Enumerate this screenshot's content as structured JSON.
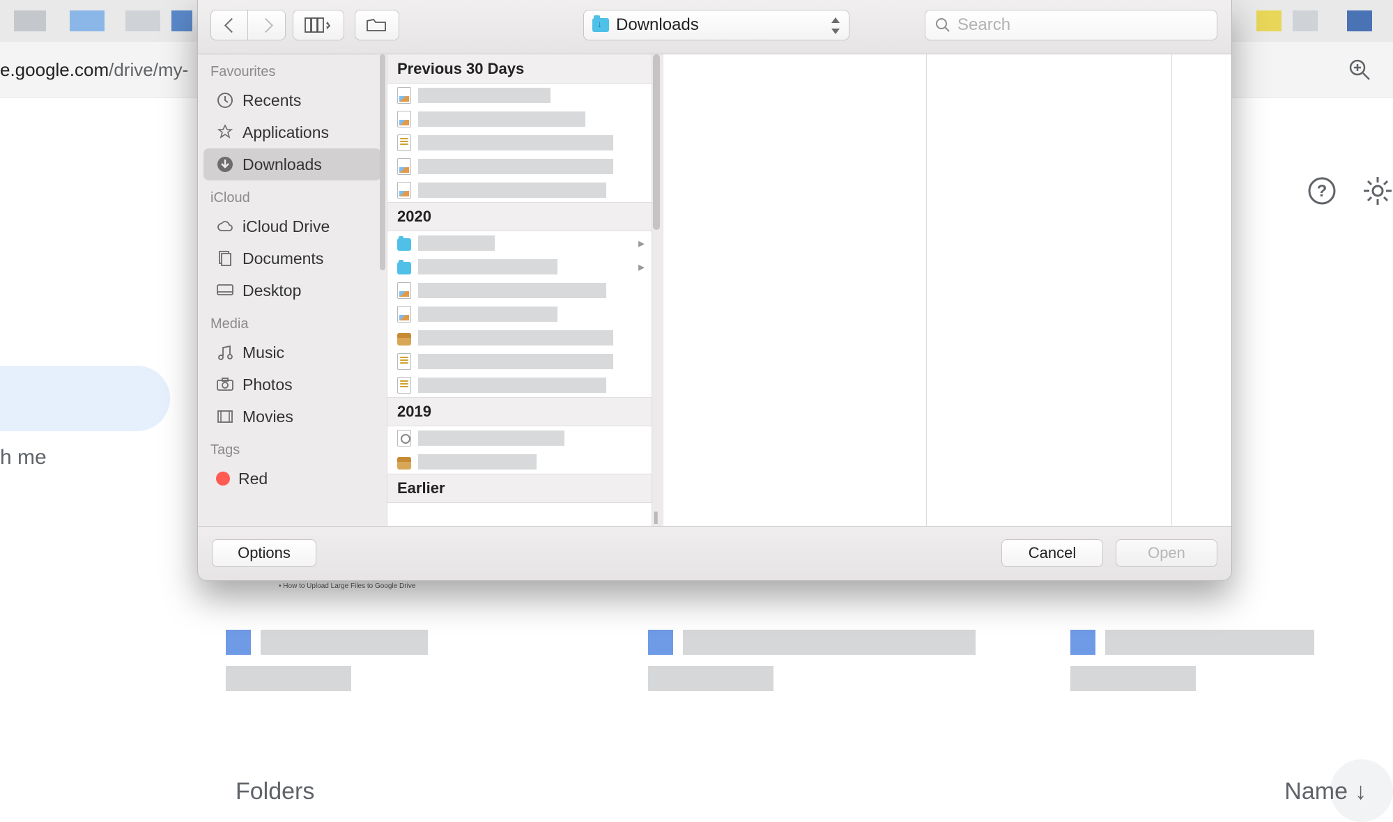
{
  "browser": {
    "url_prefix": "e.google.com",
    "url_rest": "/drive/my-"
  },
  "drive": {
    "left_truncated": "h me",
    "folders_label": "Folders",
    "name_label": "Name"
  },
  "toolbar": {
    "path_label": "Downloads",
    "search_placeholder": "Search"
  },
  "sidebar": {
    "sections": [
      {
        "title": "Favourites",
        "items": [
          {
            "key": "recents",
            "label": "Recents"
          },
          {
            "key": "applications",
            "label": "Applications"
          },
          {
            "key": "downloads",
            "label": "Downloads",
            "selected": true
          }
        ]
      },
      {
        "title": "iCloud",
        "items": [
          {
            "key": "icloud-drive",
            "label": "iCloud Drive"
          },
          {
            "key": "documents",
            "label": "Documents"
          },
          {
            "key": "desktop",
            "label": "Desktop"
          }
        ]
      },
      {
        "title": "Media",
        "items": [
          {
            "key": "music",
            "label": "Music"
          },
          {
            "key": "photos",
            "label": "Photos"
          },
          {
            "key": "movies",
            "label": "Movies"
          }
        ]
      },
      {
        "title": "Tags",
        "items": [
          {
            "key": "red",
            "label": "Red",
            "color": "#ff5b52"
          }
        ]
      }
    ]
  },
  "list": {
    "groups": [
      {
        "title": "Previous 30 Days",
        "rows": [
          {
            "type": "img"
          },
          {
            "type": "img"
          },
          {
            "type": "txt"
          },
          {
            "type": "img"
          },
          {
            "type": "img"
          }
        ]
      },
      {
        "title": "2020",
        "rows": [
          {
            "type": "fold",
            "expandable": true
          },
          {
            "type": "fold",
            "expandable": true
          },
          {
            "type": "img"
          },
          {
            "type": "img"
          },
          {
            "type": "pkg"
          },
          {
            "type": "txt"
          },
          {
            "type": "txt"
          }
        ]
      },
      {
        "title": "2019",
        "rows": [
          {
            "type": "dmg"
          },
          {
            "type": "pkg"
          }
        ]
      },
      {
        "title": "Earlier",
        "rows": []
      }
    ]
  },
  "footer": {
    "options": "Options",
    "cancel": "Cancel",
    "open": "Open"
  },
  "background_text": {
    "tip": "How to Upload Large Files to Google Drive"
  }
}
